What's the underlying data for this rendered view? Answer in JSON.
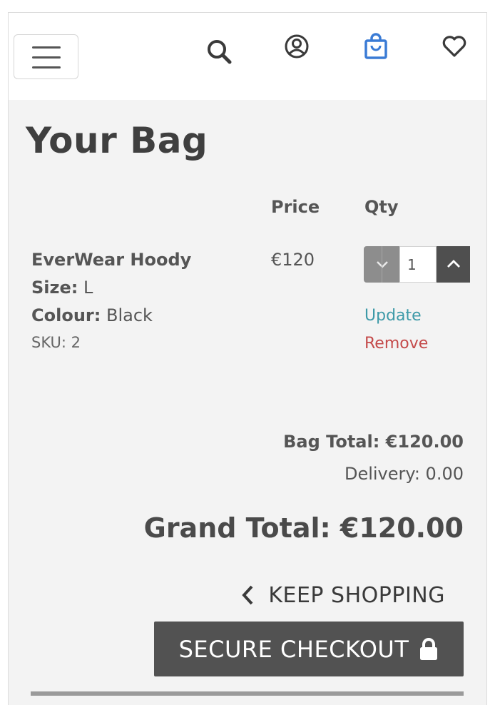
{
  "header": {
    "menu_icon": "hamburger-icon",
    "icons": [
      "search-icon",
      "account-icon",
      "shopping-bag-icon",
      "heart-icon"
    ],
    "active_icon_color": "#3a7bd5"
  },
  "page": {
    "title": "Your Bag"
  },
  "table": {
    "columns": {
      "price": "Price",
      "qty": "Qty"
    }
  },
  "item": {
    "name": "EverWear Hoody",
    "size_label": "Size:",
    "size_value": "L",
    "colour_label": "Colour:",
    "colour_value": "Black",
    "sku": "SKU: 2",
    "price": "€120",
    "quantity": "1",
    "update_label": "Update",
    "remove_label": "Remove"
  },
  "totals": {
    "bag_total": "Bag Total: €120.00",
    "delivery": "Delivery: 0.00",
    "grand_total": "Grand Total: €120.00"
  },
  "actions": {
    "keep_shopping": "KEEP SHOPPING",
    "secure_checkout": "SECURE CHECKOUT"
  },
  "colors": {
    "update_link": "#3d9aa8",
    "remove_link": "#c44a4a",
    "checkout_bg": "#525252"
  }
}
